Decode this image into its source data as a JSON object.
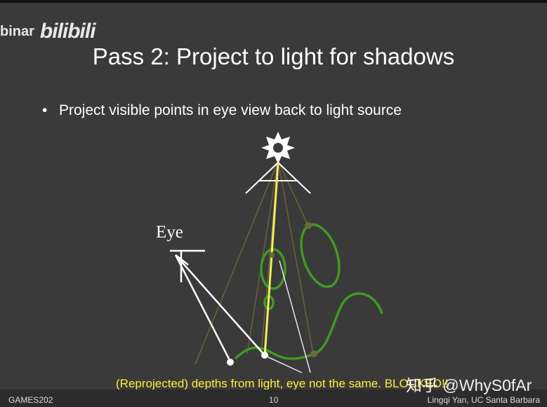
{
  "header": {
    "brand_text": "binar",
    "logo_text": "bilibili"
  },
  "slide": {
    "title": "Pass 2: Project to light for shadows",
    "bullet": "Project visible points in eye view back to light source",
    "eye_label": "Eye",
    "caption": "(Reprojected) depths from light, eye not the same. BLOCKED!!"
  },
  "footer": {
    "left": "GAMES202",
    "page": "10",
    "right": "Lingqi Yan, UC Santa Barbara"
  },
  "watermark": "知乎 @WhyS0fAr",
  "colors": {
    "background": "#3a3a3a",
    "title": "#ffffff",
    "caption": "#ffef3a",
    "green": "#3f9a24",
    "light_ray": "#f5ee5a"
  }
}
